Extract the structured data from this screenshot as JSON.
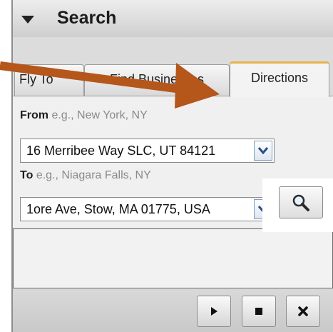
{
  "header": {
    "title": "Search"
  },
  "tabs": [
    {
      "label": "Fly To"
    },
    {
      "label": "Find Businesses"
    },
    {
      "label": "Directions",
      "active": true
    }
  ],
  "directions": {
    "from_label": "From",
    "from_hint": "e.g., New York, NY",
    "from_value": "16 Merribee Way SLC, UT 84121",
    "to_label": "To",
    "to_hint": "e.g., Niagara Falls, NY",
    "to_value": "1ore Ave, Stow, MA 01775, USA"
  },
  "icons": {
    "collapse": "triangle-down-icon",
    "dropdown": "chevron-down-icon",
    "search": "magnifier-icon",
    "play": "play-icon",
    "stop": "stop-icon",
    "close": "close-icon",
    "annotation": "arrow-pointer"
  },
  "colors": {
    "accent_tab_top": "#e8b34a",
    "annotation_arrow": "#b5561a"
  }
}
